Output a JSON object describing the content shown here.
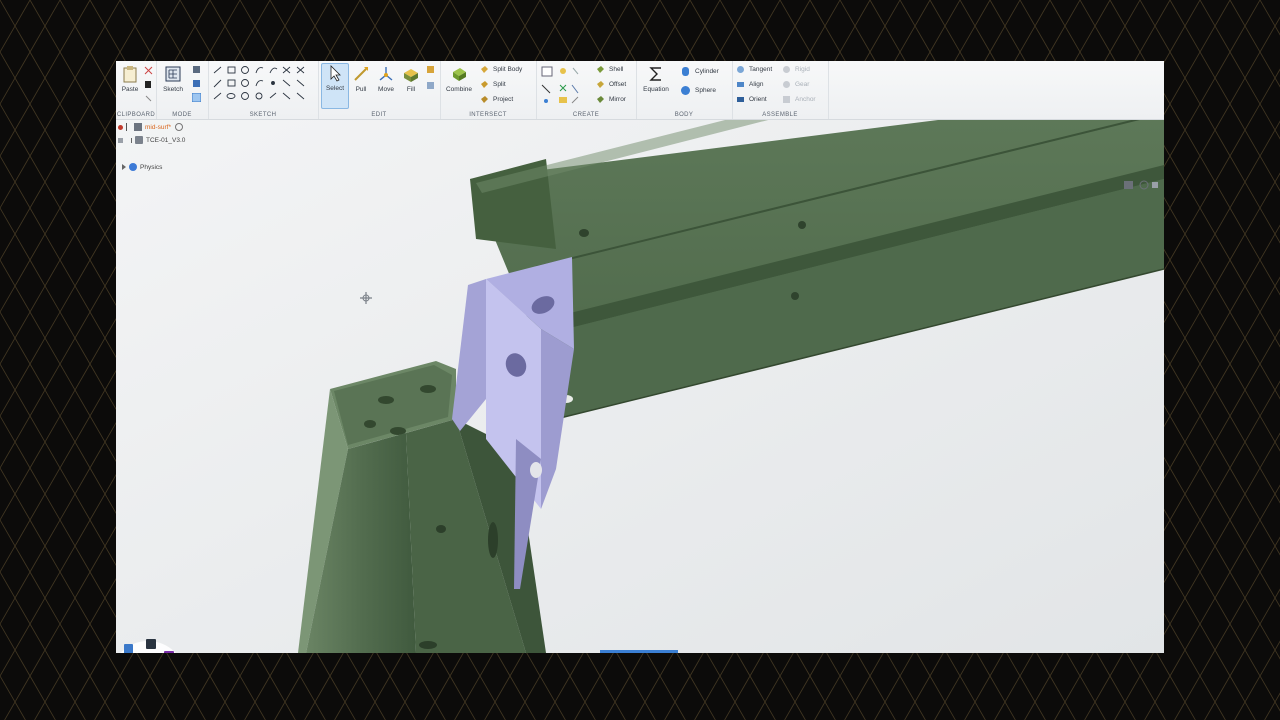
{
  "ribbon": {
    "groups": {
      "clipboard": "Clipboard",
      "mode": "Mode",
      "sketch": "Sketch",
      "edit": "Edit",
      "intersect": "Intersect",
      "create": "Create",
      "body": "Body",
      "assemble": "Assemble"
    },
    "tools": {
      "paste": "Paste",
      "sketch": "Sketch",
      "select": "Select",
      "pull": "Pull",
      "move": "Move",
      "fill": "Fill",
      "combine": "Combine",
      "split_body": "Split Body",
      "split": "Split",
      "project": "Project",
      "shell": "Shell",
      "offset": "Offset",
      "mirror": "Mirror",
      "equation": "Equation",
      "cylinder": "Cylinder",
      "sphere": "Sphere",
      "tangent": "Tangent",
      "align": "Align",
      "orient": "Orient",
      "rigid": "Rigid",
      "gear": "Gear",
      "anchor": "Anchor"
    }
  },
  "tree": {
    "root": "mid-surf*",
    "child": "TCE-01_V3.0",
    "physics": "Physics"
  },
  "colors": {
    "beam_green": "#4f6a4c",
    "bracket_lavender": "#b9b8e6",
    "accent_blue": "#3b7fd3",
    "tree_root_orange": "#d9651c"
  },
  "icons": [
    "paste-icon",
    "cut-icon",
    "copy-icon",
    "sketch-icon",
    "select-icon",
    "pull-icon",
    "move-icon",
    "fill-icon",
    "combine-icon",
    "equation-icon",
    "cylinder-icon",
    "sphere-icon",
    "tangent-icon",
    "align-icon",
    "orient-icon",
    "rigid-icon",
    "gear-icon",
    "anchor-icon",
    "view-cube-icon",
    "axis-triad-icon"
  ]
}
